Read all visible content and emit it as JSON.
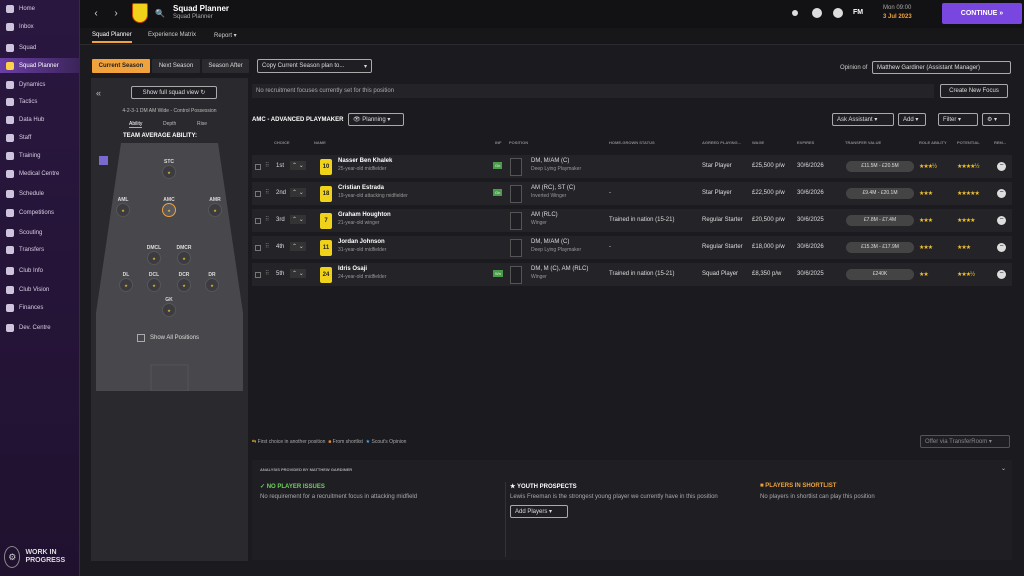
{
  "sidebar": {
    "items": [
      "Home",
      "Inbox",
      "Squad",
      "Squad Planner",
      "Dynamics",
      "Tactics",
      "Data Hub",
      "Staff",
      "Training",
      "Medical Centre",
      "Schedule",
      "Competitions",
      "Scouting",
      "Transfers",
      "Club Info",
      "Club Vision",
      "Finances",
      "Dev. Centre"
    ],
    "active": 3,
    "wip": "WORK IN PROGRESS"
  },
  "header": {
    "title": "Squad Planner",
    "subtitle": "Squad Planner",
    "fm": "FM",
    "day": "Mon 09:00",
    "date": "3 Jul 2023",
    "continue": "CONTINUE"
  },
  "tabs": [
    "Squad Planner",
    "Experience Matrix",
    "Report"
  ],
  "season": {
    "buttons": [
      "Current Season",
      "Next Season",
      "Season After"
    ],
    "copy": "Copy Current Season plan to...",
    "opinion_label": "Opinion of",
    "opinion_value": "Matthew Gardiner (Assistant Manager)"
  },
  "left": {
    "show_full": "Show full squad view",
    "formation": "4-2-3-1 DM AM Wide - Control Possession",
    "tabs": [
      "Ability",
      "Depth",
      "Rise"
    ],
    "team_ability": "TEAM AVERAGE ABILITY:",
    "show_all": "Show All Positions",
    "positions": [
      {
        "l": "STC"
      },
      {
        "l": "AML"
      },
      {
        "l": "AMC"
      },
      {
        "l": "AMR"
      },
      {
        "l": "DMCL"
      },
      {
        "l": "DMCR"
      },
      {
        "l": "DL"
      },
      {
        "l": "DCL"
      },
      {
        "l": "DCR"
      },
      {
        "l": "DR"
      },
      {
        "l": "GK"
      }
    ]
  },
  "recruit": {
    "message": "No recruitment focuses currently set for this position",
    "create": "Create New Focus"
  },
  "role": {
    "title": "AMC - ADVANCED PLAYMAKER",
    "planning": "Planning",
    "ask": "Ask Assistant",
    "add": "Add",
    "filter": "Filter"
  },
  "columns": [
    "CHOICE",
    "NAME",
    "INF",
    "POSITION",
    "HOME-GROWN STATUS",
    "AGREED PLAYING...",
    "WAGE",
    "EXPIRES",
    "TRANSFER VALUE",
    "ROLE ABILITY",
    "POTENTIAL",
    "REM..."
  ],
  "players": [
    {
      "choice": "1st",
      "num": "10",
      "name": "Nasser Ben Khalek",
      "desc": "25-year-old midfielder",
      "inf": "Gn",
      "pos": "DM, M/AM (C)",
      "role": "Deep Lying Playmaker",
      "hg": "",
      "agreed": "Star Player",
      "wage": "£25,500 p/w",
      "exp": "30/6/2026",
      "fee": "£11.5M - £20.5M",
      "ra": "★★★½",
      "pot": "★★★★½"
    },
    {
      "choice": "2nd",
      "num": "18",
      "name": "Cristian Estrada",
      "desc": "19-year-old attacking midfielder",
      "inf": "Gn",
      "pos": "AM (RC), ST (C)",
      "role": "Inverted Winger",
      "hg": "-",
      "agreed": "Star Player",
      "wage": "£22,500 p/w",
      "exp": "30/6/2026",
      "fee": "£9.4M - £20.1M",
      "ra": "★★★",
      "pot": "★★★★★"
    },
    {
      "choice": "3rd",
      "num": "7",
      "name": "Graham Houghton",
      "desc": "21-year-old winger",
      "inf": "",
      "pos": "AM (RLC)",
      "role": "Winger",
      "hg": "Trained in nation (15-21)",
      "agreed": "Regular Starter",
      "wage": "£20,500 p/w",
      "exp": "30/6/2025",
      "fee": "£7.8M - £7.4M",
      "ra": "★★★",
      "pot": "★★★★"
    },
    {
      "choice": "4th",
      "num": "11",
      "name": "Jordan Johnson",
      "desc": "31-year-old midfielder",
      "inf": "",
      "pos": "DM, M/AM (C)",
      "role": "Deep Lying Playmaker",
      "hg": "-",
      "agreed": "Regular Starter",
      "wage": "£18,000 p/w",
      "exp": "30/6/2026",
      "fee": "£15.3M - £17.9M",
      "ra": "★★★",
      "pot": "★★★"
    },
    {
      "choice": "5th",
      "num": "24",
      "name": "Idris Osaji",
      "desc": "24-year-old midfielder",
      "inf": "Wn",
      "pos": "DM, M (C), AM (RLC)",
      "role": "Winger",
      "hg": "Trained in nation (15-21)",
      "agreed": "Squad Player",
      "wage": "£8,350 p/w",
      "exp": "30/6/2025",
      "fee": "£240K",
      "ra": "★★",
      "pot": "★★★½"
    }
  ],
  "legend": {
    "first": "First choice in another position",
    "shortlist": "From shortlist",
    "scout": "Scout's Opinion",
    "offer": "Offer via TransferRoom"
  },
  "analysis": {
    "heading": "ANALYSIS PROVIDED BY MATTHEW GARDINER",
    "issues_title": "NO PLAYER ISSUES",
    "issues_text": "No requirement for a recruitment focus in attacking midfield",
    "youth_title": "YOUTH PROSPECTS",
    "youth_text": "Lewis Freeman is the strongest young player we currently have in this position",
    "youth_btn": "Add Players",
    "short_title": "PLAYERS IN SHORTLIST",
    "short_text": "No players in shortlist can play this position"
  }
}
